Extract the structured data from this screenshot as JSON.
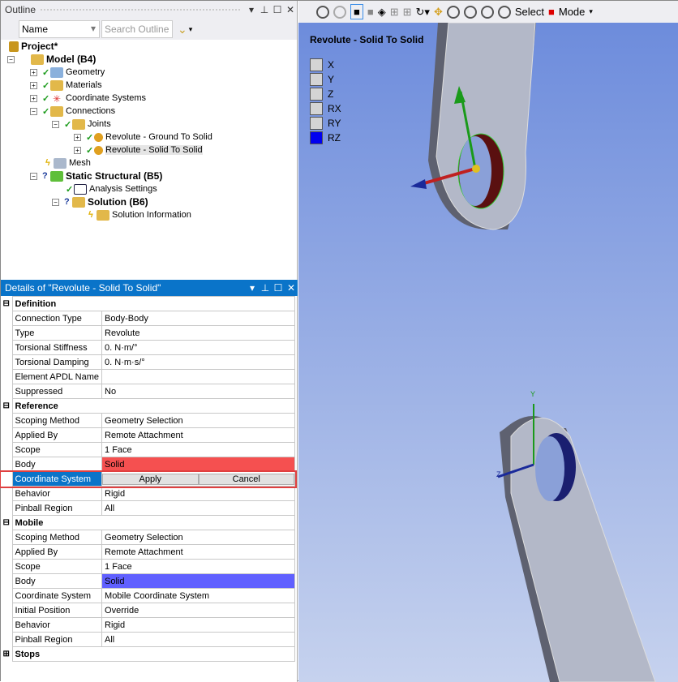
{
  "outline": {
    "title": "Outline",
    "filter": "Name",
    "search_placeholder": "Search Outline",
    "tree": [
      "Project*",
      "Model (B4)",
      "Geometry",
      "Materials",
      "Coordinate Systems",
      "Connections",
      "Joints",
      "Revolute - Ground To Solid",
      "Revolute - Solid To Solid",
      "Mesh",
      "Static Structural (B5)",
      "Analysis Settings",
      "Solution (B6)",
      "Solution Information"
    ]
  },
  "details": {
    "title": "Details of \"Revolute - Solid To Solid\"",
    "definition": {
      "label": "Definition",
      "rows": [
        [
          "Connection Type",
          "Body-Body"
        ],
        [
          "Type",
          "Revolute"
        ],
        [
          "Torsional Stiffness",
          "0. N·m/°"
        ],
        [
          "Torsional Damping",
          "0. N·m·s/°"
        ],
        [
          "Element APDL Name",
          ""
        ],
        [
          "Suppressed",
          "No"
        ]
      ]
    },
    "reference": {
      "label": "Reference",
      "rows": [
        [
          "Scoping Method",
          "Geometry Selection"
        ],
        [
          "Applied By",
          "Remote Attachment"
        ],
        [
          "Scope",
          "1 Face"
        ],
        [
          "Body",
          "Solid"
        ],
        [
          "Coordinate System",
          ""
        ],
        [
          "Behavior",
          "Rigid"
        ],
        [
          "Pinball Region",
          "All"
        ]
      ]
    },
    "apply": "Apply",
    "cancel": "Cancel",
    "mobile": {
      "label": "Mobile",
      "rows": [
        [
          "Scoping Method",
          "Geometry Selection"
        ],
        [
          "Applied By",
          "Remote Attachment"
        ],
        [
          "Scope",
          "1 Face"
        ],
        [
          "Body",
          "Solid"
        ],
        [
          "Coordinate System",
          "Mobile Coordinate System"
        ],
        [
          "Initial Position",
          "Override"
        ],
        [
          "Behavior",
          "Rigid"
        ],
        [
          "Pinball Region",
          "All"
        ]
      ]
    },
    "stops": "Stops"
  },
  "viewport": {
    "toolbar": {
      "select": "Select",
      "mode": "Mode"
    },
    "title": "Revolute - Solid To Solid",
    "dofs": [
      "X",
      "Y",
      "Z",
      "RX",
      "RY",
      "RZ"
    ],
    "active_dof": "RZ",
    "axis_labels": {
      "y": "Y",
      "z": "Z"
    }
  }
}
